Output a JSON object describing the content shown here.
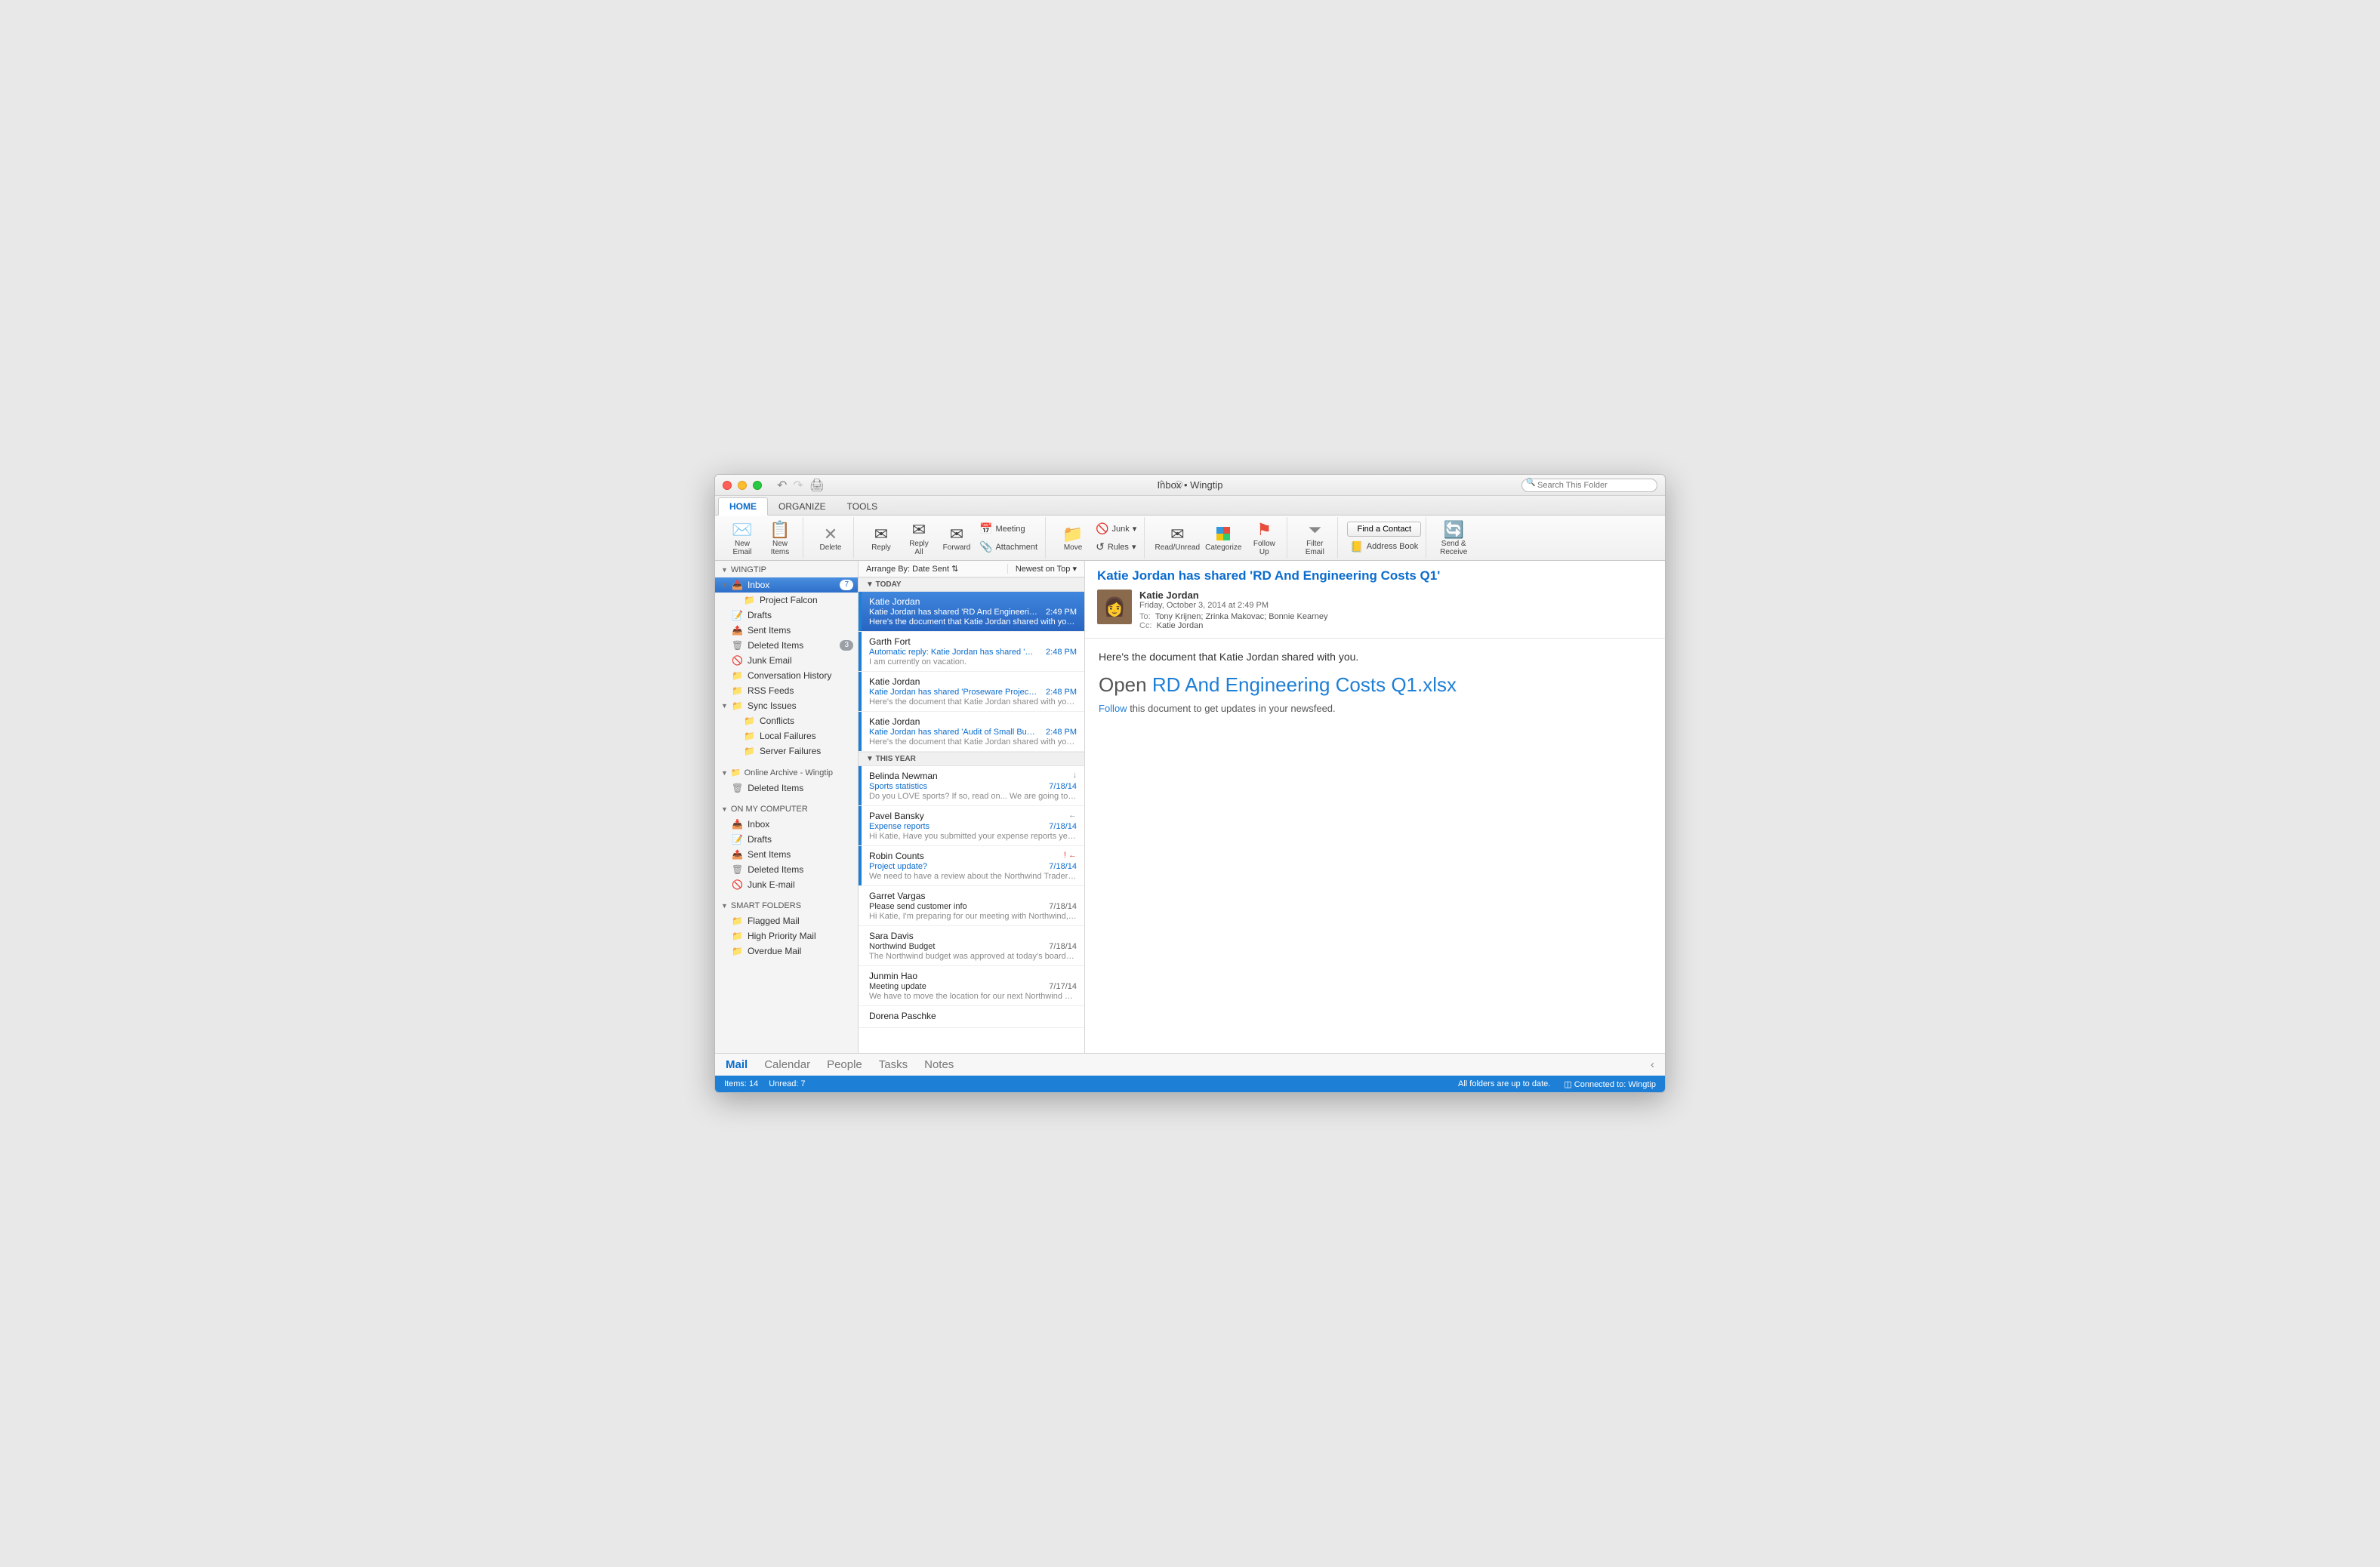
{
  "title": "Inbox • Wingtip",
  "search_placeholder": "Search This Folder",
  "tabs": {
    "home": "HOME",
    "organize": "ORGANIZE",
    "tools": "TOOLS"
  },
  "ribbon": {
    "new_email": "New\nEmail",
    "new_items": "New\nItems",
    "delete": "Delete",
    "reply": "Reply",
    "reply_all": "Reply\nAll",
    "forward": "Forward",
    "meeting": "Meeting",
    "attachment": "Attachment",
    "move": "Move",
    "junk": "Junk",
    "rules": "Rules",
    "read_unread": "Read/Unread",
    "categorize": "Categorize",
    "follow_up": "Follow\nUp",
    "filter": "Filter\nEmail",
    "find_contact": "Find a Contact",
    "address_book": "Address Book",
    "send_receive": "Send &\nReceive"
  },
  "sidebar": {
    "acct1": "WINGTIP",
    "inbox": "Inbox",
    "inbox_badge": "7",
    "project_falcon": "Project Falcon",
    "drafts": "Drafts",
    "sent": "Sent Items",
    "deleted": "Deleted Items",
    "deleted_badge": "3",
    "junk": "Junk Email",
    "conv": "Conversation History",
    "rss": "RSS Feeds",
    "sync": "Sync Issues",
    "conflicts": "Conflicts",
    "localf": "Local Failures",
    "serverf": "Server Failures",
    "archive": "Online Archive - Wingtip",
    "arch_del": "Deleted Items",
    "onmy": "ON MY COMPUTER",
    "c_inbox": "Inbox",
    "c_drafts": "Drafts",
    "c_sent": "Sent Items",
    "c_del": "Deleted Items",
    "c_junk": "Junk E-mail",
    "smart": "SMART FOLDERS",
    "flagged": "Flagged Mail",
    "hipri": "High Priority Mail",
    "overdue": "Overdue Mail"
  },
  "msglist": {
    "arrange": "Arrange By: Date Sent",
    "sort": "Newest on Top",
    "g_today": "TODAY",
    "g_year": "THIS YEAR",
    "items": [
      {
        "from": "Katie Jordan",
        "subj": "Katie Jordan has shared 'RD And Engineeri…",
        "time": "2:49 PM",
        "prev": "Here's the document that Katie Jordan shared with you…",
        "unread": true,
        "sel": true
      },
      {
        "from": "Garth Fort",
        "subj": "Automatic reply: Katie Jordan has shared '…",
        "time": "2:48 PM",
        "prev": "I am currently on vacation.",
        "unread": true
      },
      {
        "from": "Katie Jordan",
        "subj": "Katie Jordan has shared 'Proseware Projec…",
        "time": "2:48 PM",
        "prev": "Here's the document that Katie Jordan shared with you…",
        "unread": true
      },
      {
        "from": "Katie Jordan",
        "subj": "Katie Jordan has shared 'Audit of Small Bu…",
        "time": "2:48 PM",
        "prev": "Here's the document that Katie Jordan shared with you…",
        "unread": true
      },
      {
        "from": "Belinda Newman",
        "subj": "Sports statistics",
        "time": "7/18/14",
        "prev": "Do you LOVE sports? If so, read on... We are going to…",
        "unread": true,
        "ind": "↓"
      },
      {
        "from": "Pavel Bansky",
        "subj": "Expense reports",
        "time": "7/18/14",
        "prev": "Hi Katie, Have you submitted your expense reports yet…",
        "unread": true,
        "ind": "←"
      },
      {
        "from": "Robin Counts",
        "subj": "Project update?",
        "time": "7/18/14",
        "prev": "We need to have a review about the Northwind Traders…",
        "unread": true,
        "ind": "! ←",
        "imp": true
      },
      {
        "from": "Garret Vargas",
        "subj": "Please send customer info",
        "time": "7/18/14",
        "prev": "Hi Katie, I'm preparing for our meeting with Northwind,…",
        "read": true
      },
      {
        "from": "Sara Davis",
        "subj": "Northwind Budget",
        "time": "7/18/14",
        "prev": "The Northwind budget was approved at today's board…",
        "read": true
      },
      {
        "from": "Junmin Hao",
        "subj": "Meeting update",
        "time": "7/17/14",
        "prev": "We have to move the location for our next Northwind Tr…",
        "read": true
      },
      {
        "from": "Dorena Paschke",
        "subj": "",
        "time": "",
        "prev": "",
        "read": true
      }
    ]
  },
  "pane": {
    "subject": "Katie Jordan has shared 'RD And Engineering Costs Q1'",
    "sender": "Katie Jordan",
    "date": "Friday, October 3, 2014 at 2:49 PM",
    "to_lbl": "To:",
    "to": "Tony Krijnen;   Zrinka Makovac;   Bonnie Kearney",
    "cc_lbl": "Cc:",
    "cc": "Katie Jordan",
    "line1": "Here's the document that Katie Jordan shared with you.",
    "open": "Open ",
    "doc": "RD And Engineering Costs Q1.xlsx",
    "follow": "Follow",
    "follow2": " this document to get updates in your newsfeed."
  },
  "bnav": {
    "mail": "Mail",
    "calendar": "Calendar",
    "people": "People",
    "tasks": "Tasks",
    "notes": "Notes"
  },
  "status": {
    "items": "Items: 14",
    "unread": "Unread: 7",
    "sync": "All folders are up to date.",
    "conn": "Connected to: Wingtip"
  }
}
